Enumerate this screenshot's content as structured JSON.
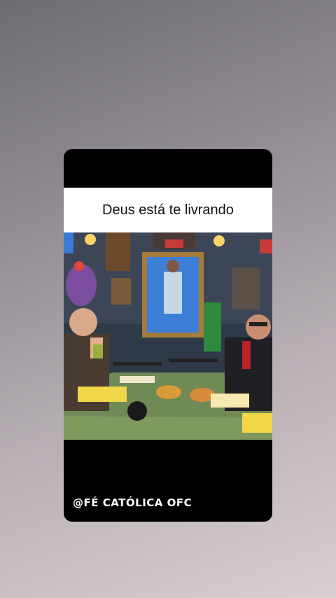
{
  "caption": "Deus está te livrando",
  "watermark": "@FÉ CATÓLICA OFC",
  "colors": {
    "card_background": "#000000",
    "caption_background": "#ffffff",
    "caption_text": "#111111",
    "watermark_text": "#ffffff"
  }
}
